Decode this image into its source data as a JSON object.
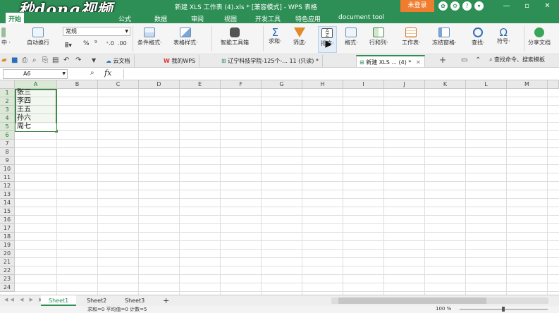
{
  "titlebar": {
    "watermark": "秒dong视频",
    "title": "新建 XLS 工作表 (4).xls * [兼容模式] - WPS 表格",
    "login": "未登录",
    "win_min": "—",
    "win_max": "▫",
    "win_close": "✕"
  },
  "menu": {
    "items": [
      "开始",
      "公式",
      "数据",
      "审阅",
      "视图",
      "开发工具",
      "特色应用",
      "document tool"
    ]
  },
  "ribbon": {
    "merge": "中 ·",
    "wrap": "自动换行",
    "number_format": "常规",
    "percent": "%",
    "cond_format": "条件格式·",
    "table_style": "表格样式·",
    "smart_toolbox": "智能工具箱",
    "sum": "求和·",
    "filter": "筛选·",
    "sort": "排序·",
    "format": "格式·",
    "rows_cols": "行和列·",
    "worksheet": "工作表·",
    "freeze": "冻结窗格·",
    "find": "查找·",
    "symbol": "符号·",
    "share": "分享文档"
  },
  "tabs": {
    "cloud": "云文档",
    "mywps": "我的WPS",
    "doc1": "辽宁科技学院-125个-... 11 (只读) *",
    "doc2": "新建 XLS ... (4) *",
    "search": "查找命令、搜索模板"
  },
  "formula": {
    "namebox": "A6",
    "fx": "fx",
    "content": ""
  },
  "columns": [
    "A",
    "B",
    "C",
    "D",
    "E",
    "F",
    "G",
    "H",
    "I",
    "J",
    "K",
    "L",
    "M"
  ],
  "rows": [
    "1",
    "2",
    "3",
    "4",
    "5",
    "6",
    "7",
    "8",
    "9",
    "10",
    "11",
    "12",
    "13",
    "14",
    "15",
    "16",
    "17",
    "18",
    "19",
    "20",
    "21",
    "22",
    "23",
    "24"
  ],
  "cells": {
    "a1": "张三",
    "a2": "李四",
    "a3": "王五",
    "a4": "孙六",
    "a5": "周七"
  },
  "sheets": [
    "Sheet1",
    "Sheet2",
    "Sheet3"
  ],
  "status": {
    "text": "求和=0  平均值=0  计数=5",
    "zoom": "100 %"
  },
  "colors": {
    "brand": "#2d8f55",
    "login": "#f07c2e",
    "selection": "#3f8a46"
  }
}
